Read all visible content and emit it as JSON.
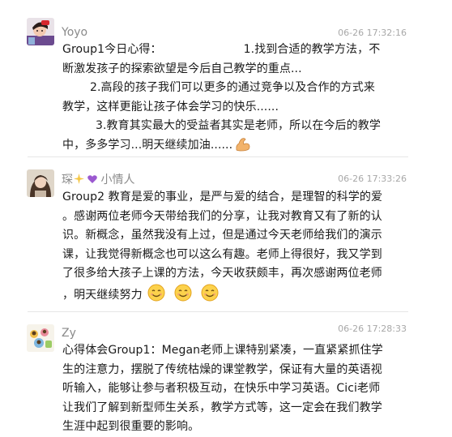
{
  "comments": [
    {
      "username": "Yoyo",
      "timestamp": "06-26 17:32:16",
      "text": {
        "line1a": "Group1今日心得：",
        "line1b": "1.找到合适的教学方法，不",
        "line2": "断激发孩子的探索欲望是今后自己教学的重点...",
        "line3": "2.高段的孩子我们可以更多的通过竞争以及合作的方式来",
        "line4": "教学，这样更能让孩子体会学习的快乐......",
        "line5": "3.教育其实最大的受益者其实是老师，所以在今后的教学",
        "line6": "中，多多学习...明天继续加油......"
      },
      "emoji": "flexed-biceps-icon"
    },
    {
      "username_part1": "琛",
      "username_part2": "小情人",
      "timestamp": "06-26 17:33:26",
      "text": {
        "line1": "Group2 教育是爱的事业，是严与爱的结合，是理智的科学的爱",
        "line2": "。感谢两位老师今天带给我们的分享，让我对教育又有了新的认",
        "line3": "识。新概念，虽然我没有上过，但是通过今天老师给我们的演示",
        "line4": "课，让我觉得新概念也可以这么有趣。老师上得很好，我又学到",
        "line5": "了很多给大孩子上课的方法，今天收获颇丰，再次感谢两位老师",
        "line6": "，明天继续努力"
      },
      "emoji": "smiling-face-icon"
    },
    {
      "username": "Zy",
      "timestamp": "06-26 17:28:33",
      "text": {
        "line1": "心得体会Group1：Megan老师上课特别紧凑，一直紧紧抓住学",
        "line2": "生的注意力，摆脱了传统枯燥的课堂教学，保证有大量的英语视",
        "line3": "听输入，能够让参与者积极互动，在快乐中学习英语。Cici老师",
        "line4": "让我们了解到新型师生关系，教学方式等，这一定会在我们教学",
        "line5": "生涯中起到很重要的影响。"
      }
    }
  ]
}
